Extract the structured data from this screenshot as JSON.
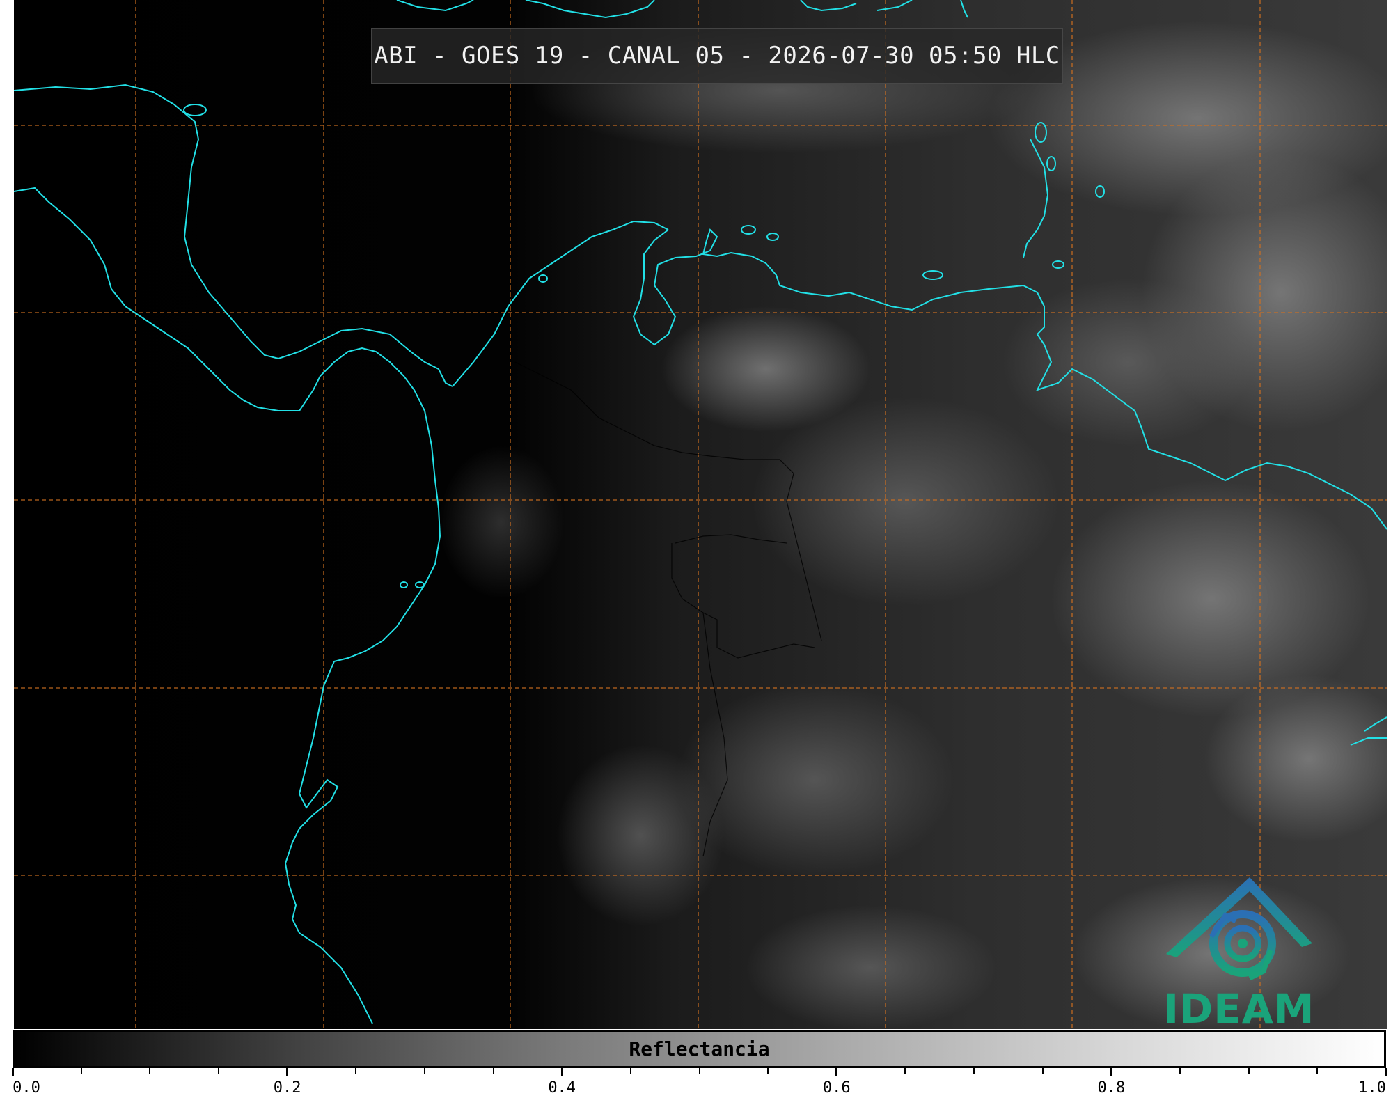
{
  "title": "ABI - GOES 19 - CANAL 05 - 2026-07-30 05:50 HLC",
  "logo": {
    "text": "IDEAM",
    "icon": "ideam-mountain-spiral-logo"
  },
  "colorbar": {
    "label": "Reflectancia",
    "range": [
      0.0,
      1.0
    ],
    "major_ticks": [
      "0.0",
      "0.2",
      "0.4",
      "0.6",
      "0.8",
      "1.0"
    ],
    "minor_step": 0.05
  },
  "colors": {
    "coastline": "#22e0e6",
    "gridline": "#d07020",
    "background_ocean": "#000000",
    "logo_blue": "#2b6fb5",
    "logo_green": "#1aa37a"
  }
}
